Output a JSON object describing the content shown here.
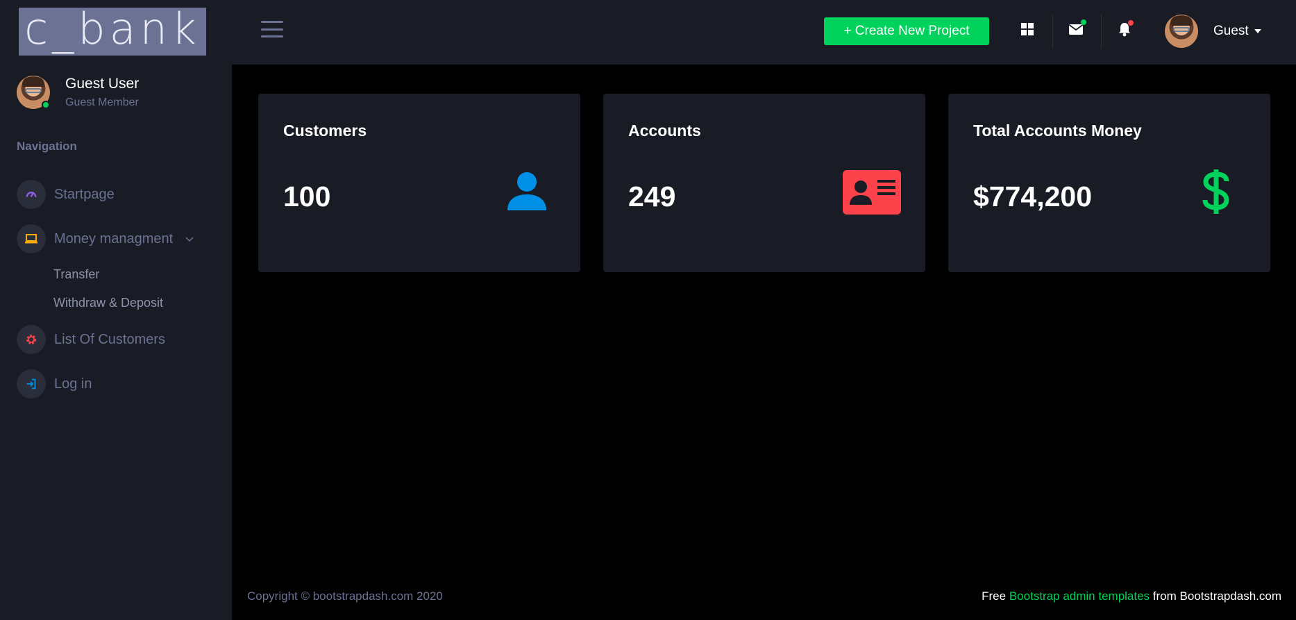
{
  "brand": {
    "logo_text": "c_bank"
  },
  "profile": {
    "name": "Guest User",
    "role": "Guest Member"
  },
  "nav": {
    "heading": "Navigation",
    "items": [
      {
        "label": "Startpage",
        "icon": "speedometer-icon",
        "color": "#8f5fe8"
      },
      {
        "label": "Money managment",
        "icon": "laptop-icon",
        "color": "#ffab00"
      },
      {
        "label": "List Of Customers",
        "icon": "gear-icon",
        "color": "#fc424a"
      },
      {
        "label": "Log in",
        "icon": "login-icon",
        "color": "#0090e7"
      }
    ],
    "sub_items": [
      {
        "label": "Transfer"
      },
      {
        "label": "Withdraw & Deposit"
      }
    ]
  },
  "topbar": {
    "create_button": "+ Create New Project",
    "user_label": "Guest"
  },
  "cards": [
    {
      "title": "Customers",
      "value": "100",
      "icon": "user-icon",
      "color": "#0090e7"
    },
    {
      "title": "Accounts",
      "value": "249",
      "icon": "id-card-icon",
      "color": "#fc424a"
    },
    {
      "title": "Total Accounts Money",
      "value": "$774,200",
      "icon": "dollar-icon",
      "color": "#00d25b"
    }
  ],
  "footer": {
    "copyright": "Copyright © bootstrapdash.com 2020",
    "free": "Free",
    "link": "Bootstrap admin templates",
    "from": "from Bootstrapdash.com"
  },
  "colors": {
    "accent_green": "#00d25b",
    "sidebar_bg": "#191c24",
    "muted": "#6c7293",
    "notification_red": "#fc424a"
  }
}
